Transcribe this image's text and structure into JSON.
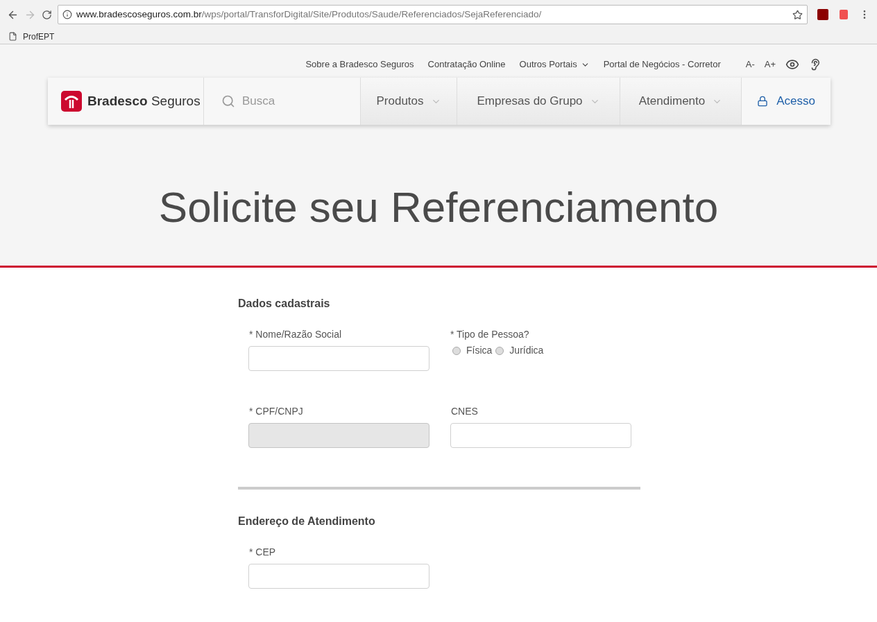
{
  "browser": {
    "url_host": "www.bradescoseguros.com.br",
    "url_path": "/wps/portal/TransforDigital/Site/Produtos/Saude/Referenciados/SejaReferenciado/",
    "bookmarks": [
      "ProfEPT"
    ]
  },
  "top_links": [
    {
      "label": "Sobre a Bradesco Seguros",
      "dropdown": false
    },
    {
      "label": "Contratação Online",
      "dropdown": false
    },
    {
      "label": "Outros Portais",
      "dropdown": true
    },
    {
      "label": "Portal de Negócios - Corretor",
      "dropdown": false
    }
  ],
  "font_controls": [
    "A-",
    "A+"
  ],
  "logo": {
    "bold": "Bradesco",
    "regular": "Seguros"
  },
  "search": {
    "placeholder": "Busca"
  },
  "nav": [
    {
      "label": "Produtos",
      "kind": "menu"
    },
    {
      "label": "Empresas do Grupo",
      "kind": "menu"
    },
    {
      "label": "Atendimento",
      "kind": "menu"
    },
    {
      "label": "Acesso",
      "kind": "login"
    }
  ],
  "hero": {
    "title": "Solicite seu Referenciamento"
  },
  "sections": [
    {
      "title": "Dados cadastrais",
      "rows": [
        [
          {
            "kind": "text",
            "label": "* Nome/Razão Social",
            "disabled": false
          },
          {
            "kind": "radio",
            "label": "* Tipo de Pessoa?",
            "options": [
              {
                "label": "Física",
                "selected": false
              },
              {
                "label": "Jurídica",
                "selected": false
              }
            ]
          }
        ],
        [
          {
            "kind": "text",
            "label": "* CPF/CNPJ",
            "disabled": true
          },
          {
            "kind": "text",
            "label": "CNES",
            "disabled": false
          }
        ]
      ]
    },
    {
      "title": "Endereço de Atendimento",
      "rows": [
        [
          {
            "kind": "text",
            "label": "* CEP",
            "disabled": false
          }
        ]
      ]
    }
  ]
}
